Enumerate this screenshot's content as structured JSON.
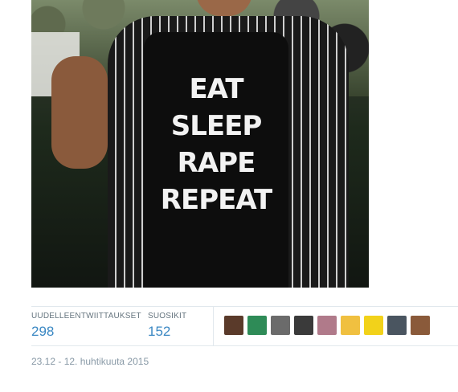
{
  "photo": {
    "shirt_lines": [
      "EAT",
      "SLEEP",
      "RAPE",
      "REPEAT"
    ]
  },
  "stats": {
    "retweets_label": "UUDELLEENTWIITTAUKSET",
    "retweets_count": "298",
    "favorites_label": "SUOSIKIT",
    "favorites_count": "152"
  },
  "avatars": [
    {
      "name": "avatar-1",
      "color": "#5a3a2a"
    },
    {
      "name": "avatar-2",
      "color": "#2e8b57"
    },
    {
      "name": "avatar-3",
      "color": "#6b6b6b"
    },
    {
      "name": "avatar-4",
      "color": "#3a3a3a"
    },
    {
      "name": "avatar-5",
      "color": "#b07a8a"
    },
    {
      "name": "avatar-6",
      "color": "#f0c040"
    },
    {
      "name": "avatar-7",
      "color": "#f2d21a"
    },
    {
      "name": "avatar-8",
      "color": "#4a5560"
    },
    {
      "name": "avatar-9",
      "color": "#8a5a3a"
    }
  ],
  "timestamp": "23.12 - 12. huhtikuuta 2015"
}
